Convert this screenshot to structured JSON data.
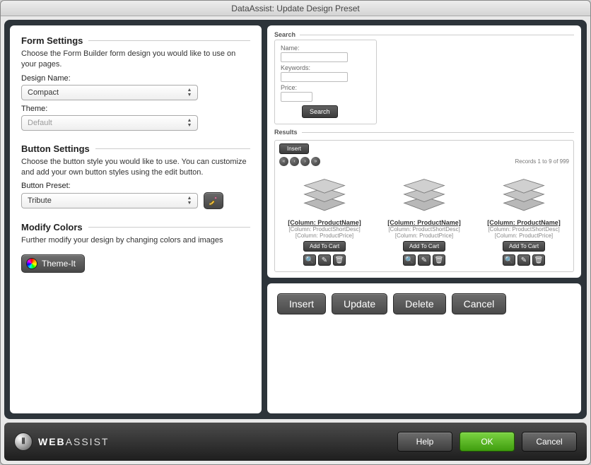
{
  "window": {
    "title": "DataAssist: Update Design Preset"
  },
  "formSettings": {
    "heading": "Form Settings",
    "desc": "Choose the Form Builder form design you would like to use on your pages.",
    "designNameLabel": "Design Name:",
    "designNameValue": "Compact",
    "themeLabel": "Theme:",
    "themeValue": "Default"
  },
  "buttonSettings": {
    "heading": "Button Settings",
    "desc": "Choose the button style you would like to use. You can customize and add your own button styles using the edit button.",
    "presetLabel": "Button Preset:",
    "presetValue": "Tribute"
  },
  "modifyColors": {
    "heading": "Modify Colors",
    "desc": "Further modify your design by changing colors and images",
    "themeItLabel": "Theme-It"
  },
  "preview": {
    "search": {
      "heading": "Search",
      "nameLabel": "Name:",
      "keywordsLabel": "Keywords:",
      "priceLabel": "Price:",
      "searchBtn": "Search"
    },
    "results": {
      "heading": "Results",
      "insertBtn": "Insert",
      "countText": "Records 1 to 9 of 999",
      "product": {
        "name": "[Column: ProductName]",
        "shortDesc": "[Column: ProductShortDesc]",
        "price": "[Column: ProductPrice]",
        "addToCart": "Add To Cart"
      }
    }
  },
  "actions": {
    "insert": "Insert",
    "update": "Update",
    "delete": "Delete",
    "cancel": "Cancel"
  },
  "footer": {
    "brandBold": "WEB",
    "brandLight": "ASSIST",
    "help": "Help",
    "ok": "OK",
    "cancel": "Cancel"
  }
}
